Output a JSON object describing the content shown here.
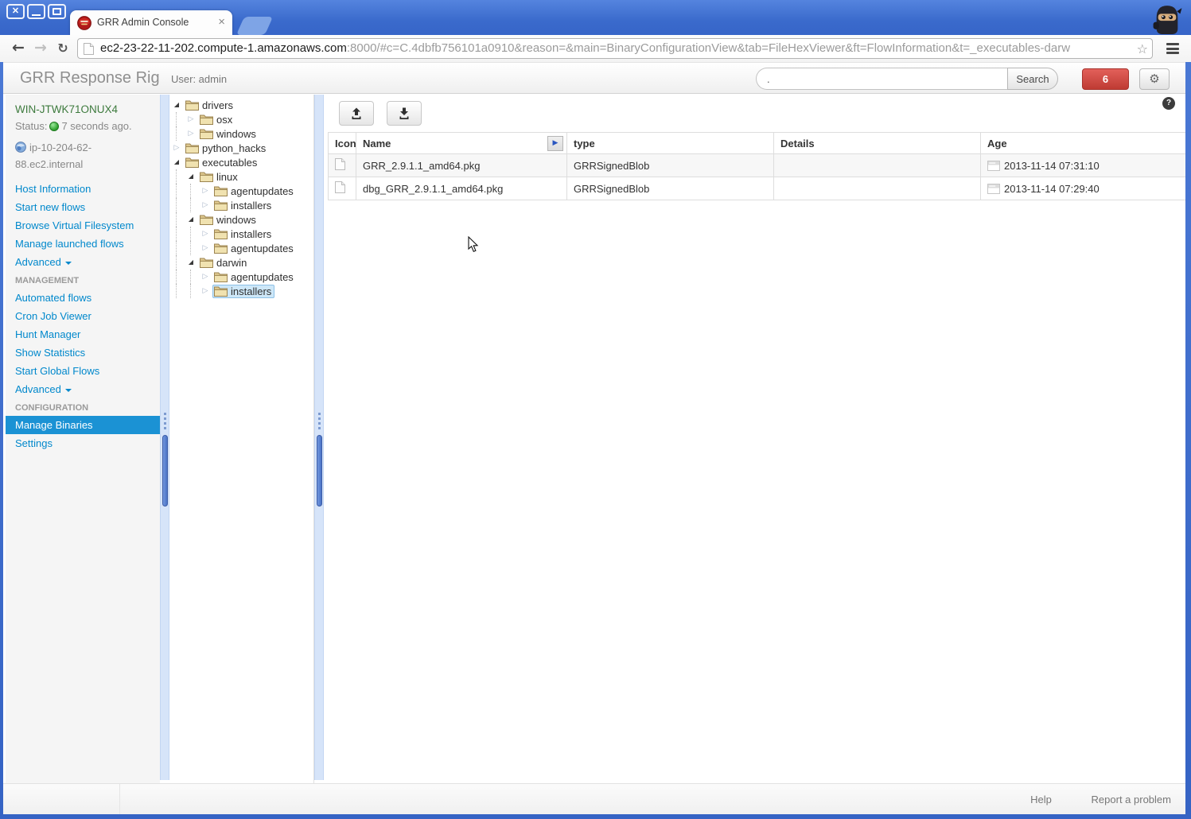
{
  "window": {
    "tab_title": "GRR Admin Console",
    "controls": {
      "close": "×",
      "minimize": "–",
      "maximize": ""
    }
  },
  "browser": {
    "url_host": "ec2-23-22-11-202.compute-1.amazonaws.com",
    "url_rest": ":8000/#c=C.4dbfb756101a0910&reason=&main=BinaryConfigurationView&tab=FileHexViewer&ft=FlowInformation&t=_executables-darw",
    "icons": {
      "back": "←",
      "forward": "→",
      "reload": "↻",
      "bookmark_star": "☆",
      "menu": "hamburger"
    }
  },
  "app_header": {
    "brand": "GRR Response Rig",
    "user": "User: admin",
    "search": {
      "value": ".",
      "button": "Search"
    },
    "notification_count": "6",
    "gear_icon": "⚙"
  },
  "sidebar": {
    "host": "WIN-JTWK71ONUX4",
    "status_label": "Status:",
    "status_text": "7 seconds ago.",
    "ip": "ip-10-204-62-88.ec2.internal",
    "items": [
      {
        "label": "Host Information",
        "type": "link"
      },
      {
        "label": "Start new flows",
        "type": "link"
      },
      {
        "label": "Browse Virtual Filesystem",
        "type": "link"
      },
      {
        "label": "Manage launched flows",
        "type": "link"
      },
      {
        "label": "Advanced",
        "type": "dropdown"
      },
      {
        "label": "MANAGEMENT",
        "type": "section"
      },
      {
        "label": "Automated flows",
        "type": "link"
      },
      {
        "label": "Cron Job Viewer",
        "type": "link"
      },
      {
        "label": "Hunt Manager",
        "type": "link"
      },
      {
        "label": "Show Statistics",
        "type": "link"
      },
      {
        "label": "Start Global Flows",
        "type": "link"
      },
      {
        "label": "Advanced",
        "type": "dropdown"
      },
      {
        "label": "CONFIGURATION",
        "type": "section"
      },
      {
        "label": "Manage Binaries",
        "type": "link",
        "selected": true
      },
      {
        "label": "Settings",
        "type": "link"
      }
    ]
  },
  "tree": {
    "items": [
      {
        "label": "drivers",
        "level": 0,
        "state": "open"
      },
      {
        "label": "osx",
        "level": 1,
        "state": "closed"
      },
      {
        "label": "windows",
        "level": 1,
        "state": "closed"
      },
      {
        "label": "python_hacks",
        "level": 0,
        "state": "closed"
      },
      {
        "label": "executables",
        "level": 0,
        "state": "open"
      },
      {
        "label": "linux",
        "level": 1,
        "state": "open"
      },
      {
        "label": "agentupdates",
        "level": 2,
        "state": "closed"
      },
      {
        "label": "installers",
        "level": 2,
        "state": "closed"
      },
      {
        "label": "windows",
        "level": 1,
        "state": "open"
      },
      {
        "label": "installers",
        "level": 2,
        "state": "closed"
      },
      {
        "label": "agentupdates",
        "level": 2,
        "state": "closed"
      },
      {
        "label": "darwin",
        "level": 1,
        "state": "open"
      },
      {
        "label": "agentupdates",
        "level": 2,
        "state": "closed"
      },
      {
        "label": "installers",
        "level": 2,
        "state": "closed",
        "selected": true
      }
    ]
  },
  "main": {
    "toolbar": {
      "upload_icon": "upload-icon",
      "download_icon": "download-icon",
      "help_label": "?"
    },
    "table": {
      "headers": {
        "icon": "Icon",
        "name": "Name",
        "type": "type",
        "details": "Details",
        "age": "Age"
      },
      "name_filter_icon": "▶",
      "rows": [
        {
          "name": "GRR_2.9.1.1_amd64.pkg",
          "type": "GRRSignedBlob",
          "details": "",
          "age": "2013-11-14 07:31:10"
        },
        {
          "name": "dbg_GRR_2.9.1.1_amd64.pkg",
          "type": "GRRSignedBlob",
          "details": "",
          "age": "2013-11-14 07:29:40"
        }
      ]
    }
  },
  "footer": {
    "help": "Help",
    "report": "Report a problem"
  },
  "colors": {
    "titlebar_blue": "#3a6acc",
    "selected_nav_blue": "#1b92d4",
    "link_blue": "#0088cc",
    "danger_red": "#bf3b33",
    "tree_selection": "#cde7f8",
    "host_green": "#3d7a3d"
  }
}
